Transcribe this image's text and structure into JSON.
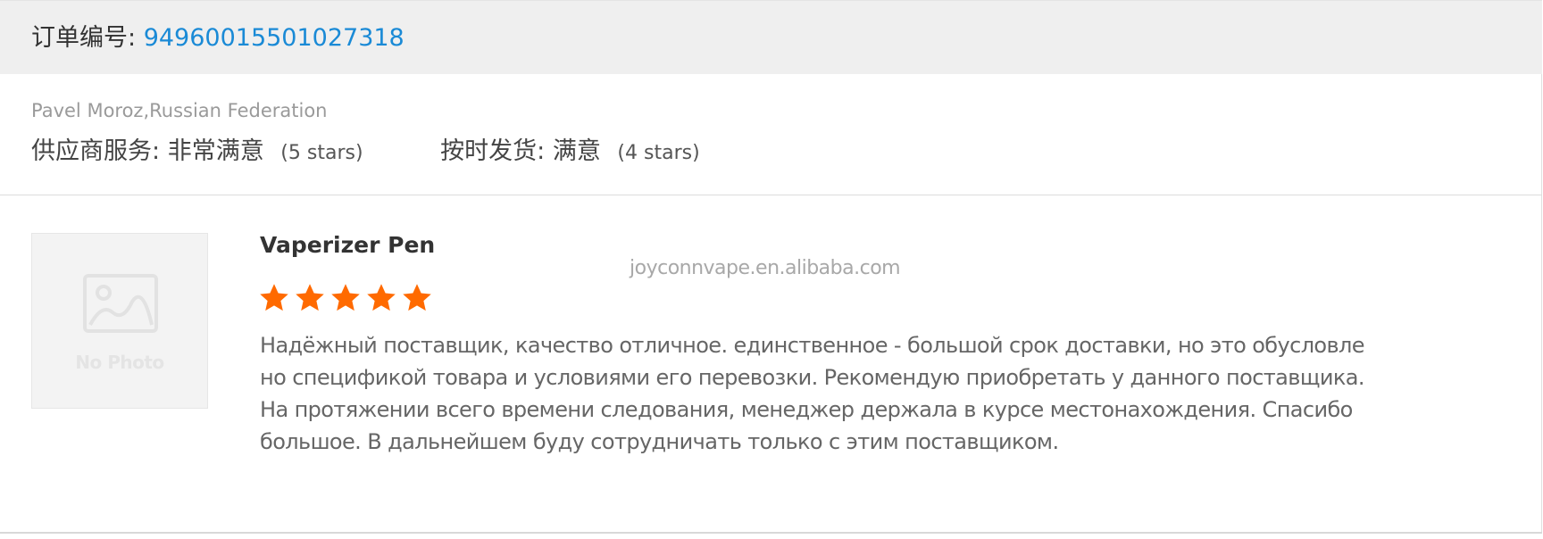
{
  "order": {
    "label": "订单编号:",
    "number": "94960015501027318"
  },
  "buyer": {
    "name_country": "Pavel Moroz,Russian Federation"
  },
  "ratings": {
    "supplier_service": {
      "label": "供应商服务:",
      "value": "非常满意",
      "stars_text": "(5 stars)"
    },
    "on_time_shipment": {
      "label": "按时发货:",
      "value": "满意",
      "stars_text": "(4 stars)"
    }
  },
  "product": {
    "thumbnail_label": "No Photo",
    "thumbnail_icon": "image-placeholder-icon",
    "title": "Vaperizer Pen",
    "star_rating": 5,
    "star_max": 5,
    "star_color": "#ff6a00"
  },
  "watermark": "joyconnvape.en.alibaba.com",
  "review": {
    "lines": [
      "Надёжный поставщик, качество отличное. единственное - большой срок доставки, но это обусловле",
      "но спецификой товара и условиями его перевозки. Рекомендую приобретать у данного поставщика.",
      "На протяжении всего времени следования, менеджер держала в курсе местонахождения. Спасибо",
      "большое. В дальнейшем буду сотрудничать только с этим поставщиком."
    ]
  },
  "colors": {
    "header_bg": "#efefef",
    "link": "#1a8ad6",
    "star": "#ff6a00",
    "muted_text": "#9a9a9a"
  }
}
